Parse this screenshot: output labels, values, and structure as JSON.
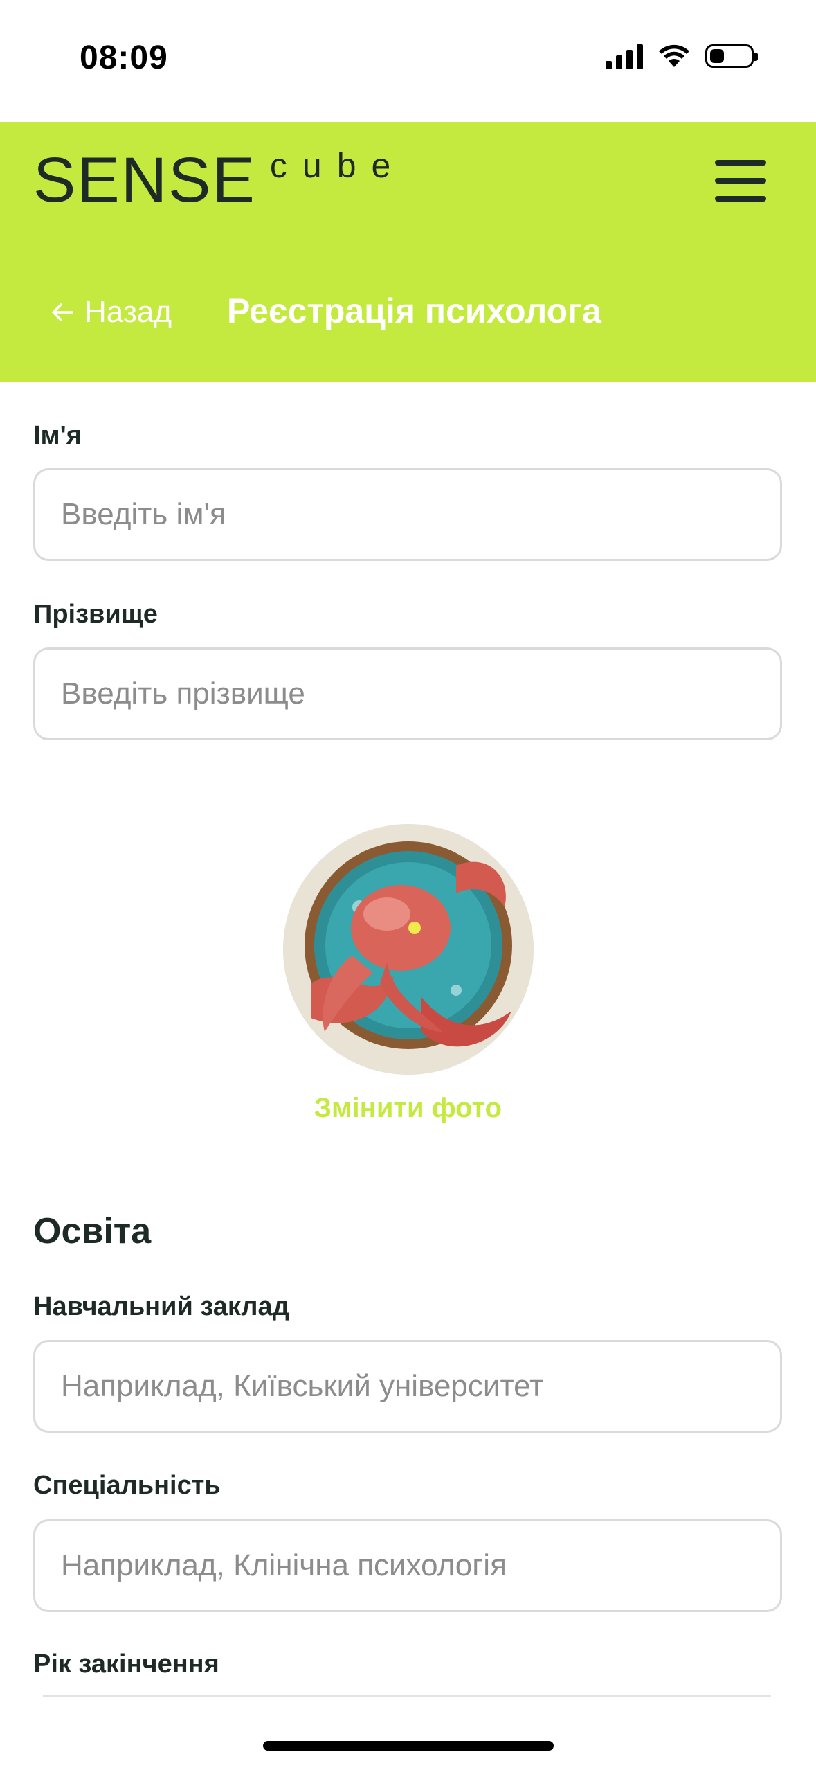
{
  "status_bar": {
    "time": "08:09",
    "icons": [
      "signal-icon",
      "wifi-icon",
      "battery-icon"
    ]
  },
  "header": {
    "logo_main": "SENSE",
    "logo_sub": "cube",
    "menu_icon": "hamburger-menu-icon",
    "back_label": "Назад",
    "title": "Реєстрація психолога",
    "background_color": "#c5ea3f"
  },
  "form": {
    "first_name": {
      "label": "Ім'я",
      "placeholder": "Введіть ім'я",
      "value": ""
    },
    "last_name": {
      "label": "Прізвище",
      "placeholder": "Введіть прізвище",
      "value": ""
    },
    "photo": {
      "change_label": "Змінити фото",
      "accent_color": "#c5ea3f"
    },
    "education": {
      "section_title": "Освіта",
      "institution": {
        "label": "Навчальний заклад",
        "placeholder": "Наприклад, Київський університет",
        "value": ""
      },
      "specialty": {
        "label": "Спеціальність",
        "placeholder": "Наприклад, Клінічна психологія",
        "value": ""
      },
      "graduation_year": {
        "label": "Рік закінчення"
      }
    }
  }
}
